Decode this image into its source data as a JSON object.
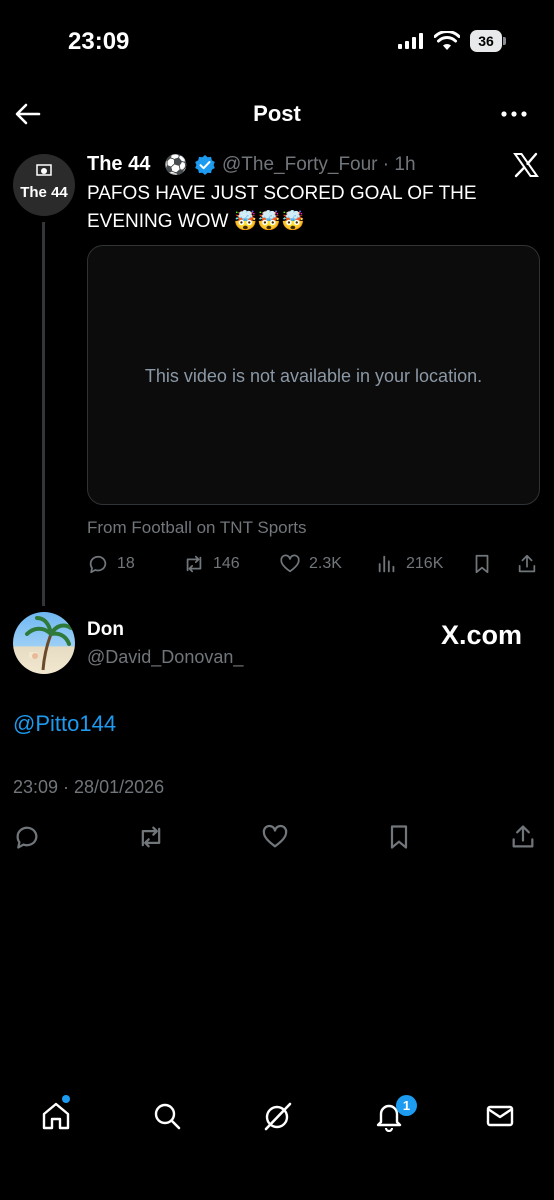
{
  "status_bar": {
    "time": "23:09",
    "battery": "36"
  },
  "header": {
    "title": "Post"
  },
  "quoted_post": {
    "avatar_text": "The 44",
    "name": "The 44",
    "name_emoji": "⚽",
    "handle": "@The_Forty_Four",
    "age": "1h",
    "text": "PAFOS HAVE JUST SCORED GOAL OF THE EVENING WOW 🤯🤯🤯",
    "video_message": "This video is not available in your location.",
    "source": "From Football on TNT Sports",
    "stats": {
      "replies": "18",
      "reposts": "146",
      "likes": "2.3K",
      "views": "216K"
    }
  },
  "reply_post": {
    "name": "Don",
    "handle": "@David_Donovan_",
    "brand": "X.com",
    "mention": "@Pitto144",
    "timestamp": "23:09 · 28/01/2026"
  },
  "bottom_nav": {
    "notification_count": "1"
  },
  "colors": {
    "accent": "#1d9bf0",
    "muted": "#71767b",
    "background": "#000000"
  }
}
